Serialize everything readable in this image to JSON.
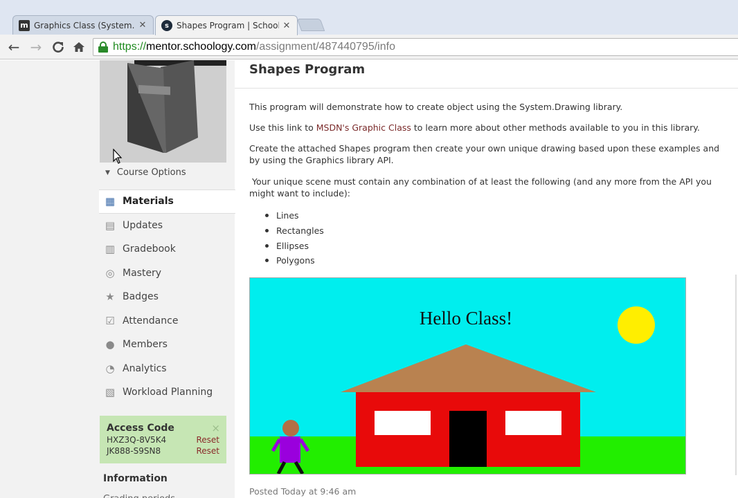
{
  "browser": {
    "tabs": [
      {
        "title": "Graphics Class (System.Dra",
        "favicon": "m",
        "active": false
      },
      {
        "title": "Shapes Program | Schoolo",
        "favicon": "s",
        "active": true
      }
    ],
    "url": {
      "scheme": "https://",
      "host": "mentor.schoology.com",
      "path": "/assignment/487440795/info"
    }
  },
  "sidebar": {
    "course_options": "Course Options",
    "nav": [
      {
        "label": "Materials",
        "icon": "materials-icon",
        "glyph": "▦",
        "active": true
      },
      {
        "label": "Updates",
        "icon": "updates-icon",
        "glyph": "▤",
        "active": false
      },
      {
        "label": "Gradebook",
        "icon": "gradebook-icon",
        "glyph": "▥",
        "active": false
      },
      {
        "label": "Mastery",
        "icon": "mastery-icon",
        "glyph": "◎",
        "active": false
      },
      {
        "label": "Badges",
        "icon": "badges-icon",
        "glyph": "★",
        "active": false
      },
      {
        "label": "Attendance",
        "icon": "attendance-icon",
        "glyph": "☑",
        "active": false
      },
      {
        "label": "Members",
        "icon": "members-icon",
        "glyph": "●",
        "active": false
      },
      {
        "label": "Analytics",
        "icon": "analytics-icon",
        "glyph": "◔",
        "active": false
      },
      {
        "label": "Workload Planning",
        "icon": "workload-icon",
        "glyph": "▧",
        "active": false
      }
    ],
    "access_code": {
      "title": "Access Code",
      "close": "×",
      "codes": [
        {
          "code": "HXZ3Q-8V5K4",
          "action": "Reset"
        },
        {
          "code": "JK888-S9SN8",
          "action": "Reset"
        }
      ]
    },
    "information_title": "Information",
    "information_cut": "Grading periods"
  },
  "main": {
    "title": "Shapes Program",
    "p1": "This program will demonstrate how to create object using the System.Drawing library.",
    "p2_before": "Use this link to ",
    "p2_link": "MSDN's Graphic Class",
    "p2_after": " to learn more about other methods available to you in this library.",
    "p3": "Create the attached Shapes program then create your own unique drawing based upon these examples and by using the Graphics library API.",
    "p4": " Your unique scene must contain any combination of at least the following (and any more from the API you might want to include):",
    "bullets": [
      "Lines",
      "Rectangles",
      "Ellipses",
      "Polygons"
    ],
    "scene_text": "Hello Class!",
    "posted": "Posted Today at 9:46 am"
  },
  "colors": {
    "sky": "#00eeee",
    "grass": "#22ee00",
    "sun": "#ffee00",
    "roof": "#b98250",
    "wall": "#e80a0a",
    "door": "#000000",
    "window": "#ffffff",
    "shirt": "#9a00dd",
    "head": "#b27045",
    "access_bg": "#c6e6b4",
    "link": "#7a2a2a"
  }
}
